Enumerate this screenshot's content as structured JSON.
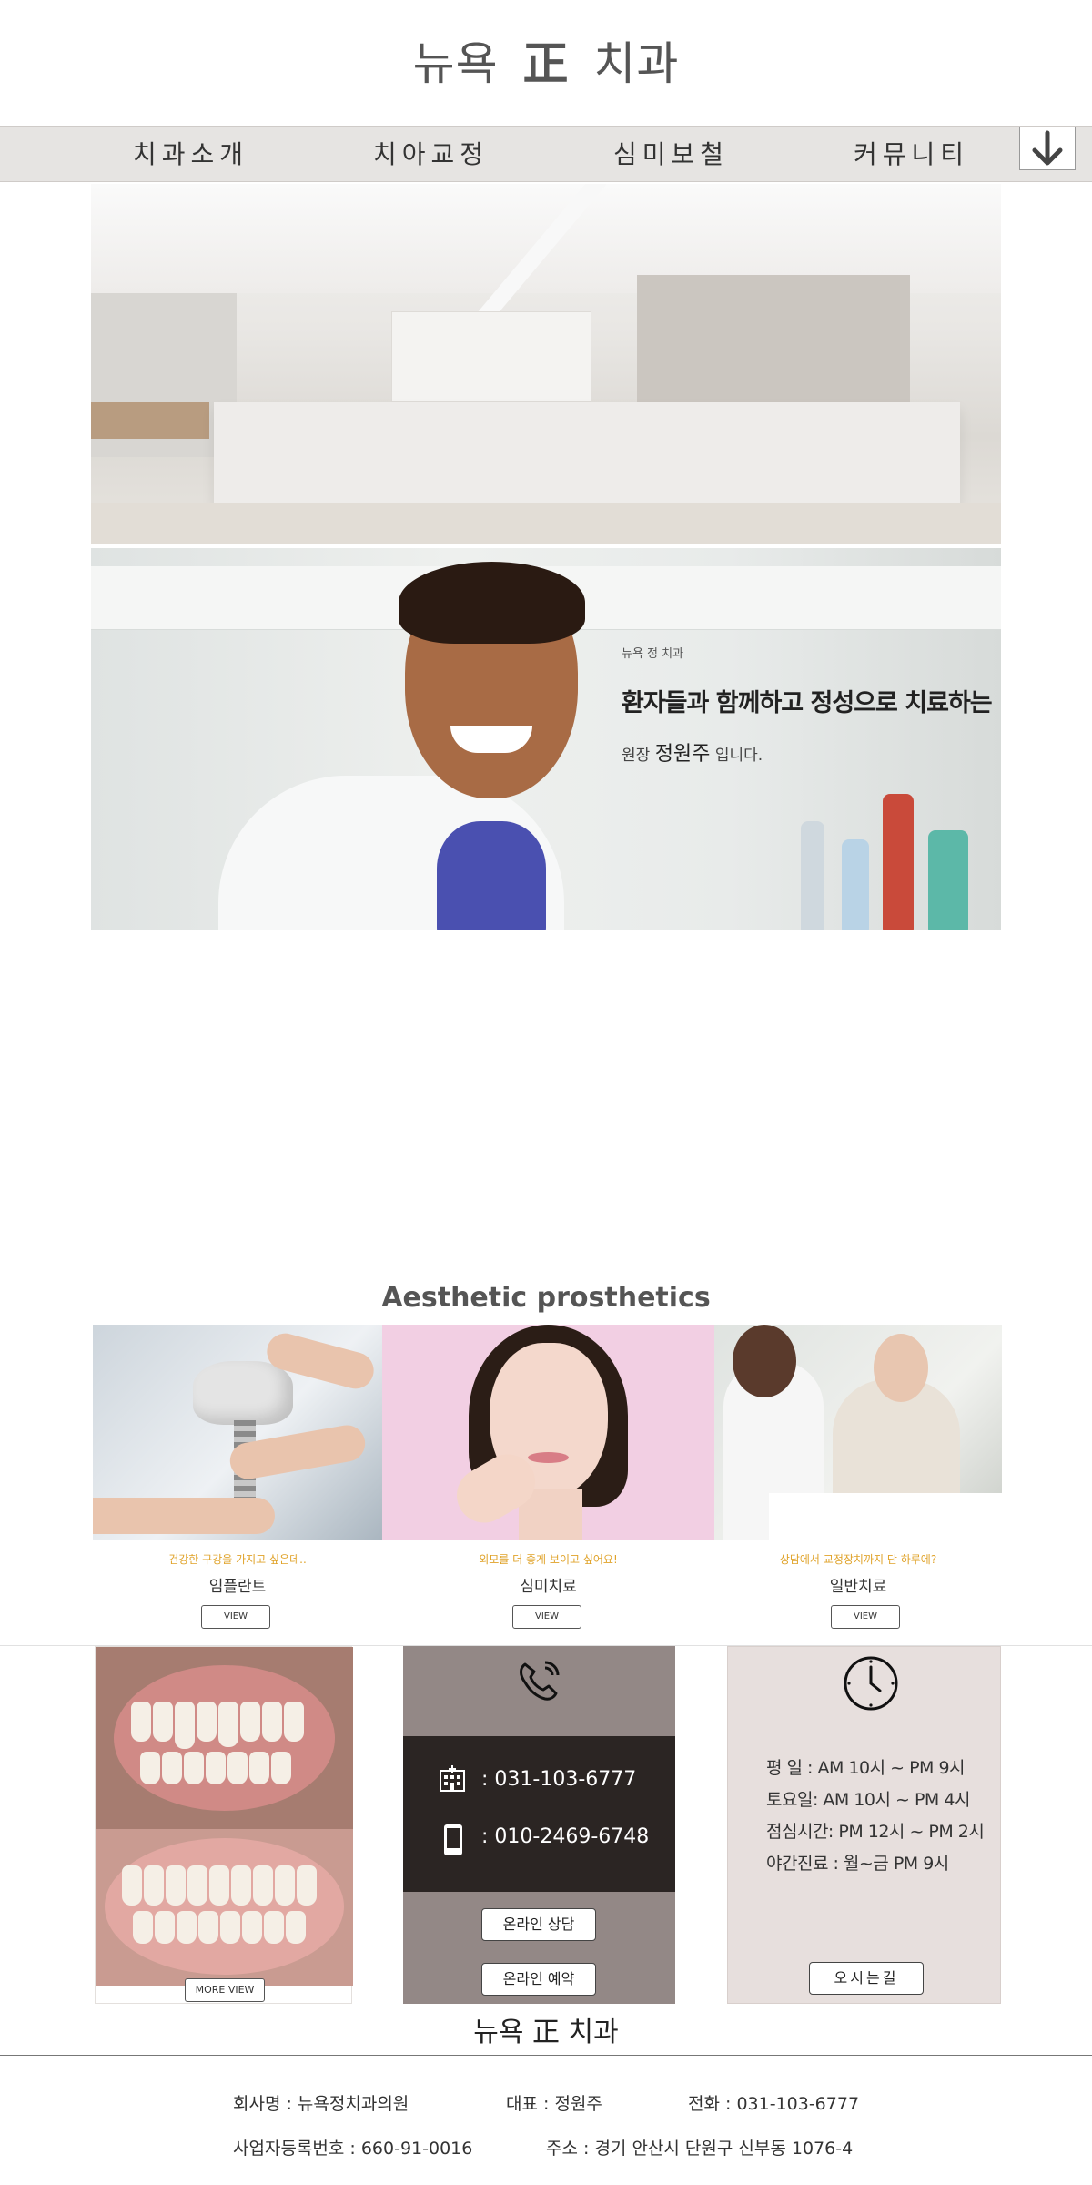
{
  "header": {
    "logo_left": "뉴욕",
    "logo_mid": "正",
    "logo_right": "치과"
  },
  "nav": {
    "items": [
      "치과소개",
      "치아교정",
      "심미보철",
      "커뮤니티"
    ],
    "arrow_icon": "arrow-down-icon"
  },
  "hero": {
    "small_caption": "뉴욕 정 치과",
    "headline": "환자들과 함께하고 정성으로 치료하는",
    "title_prefix": "원장",
    "name": "정원주",
    "suffix": "입니다."
  },
  "services": {
    "section_title": "Aesthetic prosthetics",
    "items": [
      {
        "subtitle": "건강한 구강을 가지고 싶은데..",
        "name": "임플란트",
        "button": "VIEW"
      },
      {
        "subtitle": "외모를 더 좋게 보이고 싶어요!",
        "name": "심미치료",
        "button": "VIEW"
      },
      {
        "subtitle": "상담에서 교정장치까지 단 하루에?",
        "name": "일반치료",
        "button": "VIEW"
      }
    ]
  },
  "gallery": {
    "button": "MORE VIEW"
  },
  "contact": {
    "phone_icon": "phone-icon",
    "hospital_icon": "hospital-icon",
    "mobile_icon": "mobile-icon",
    "tel": ": 031-103-6777",
    "mobile": ": 010-2469-6748",
    "consult_button": "온라인 상담",
    "reserve_button": "온라인 예약"
  },
  "hours": {
    "clock_icon": "clock-icon",
    "lines": [
      "평  일 : AM 10시 ~ PM 9시",
      "토요일: AM 10시 ~ PM 4시",
      "점심시간: PM 12시 ~ PM 2시",
      "야간진료 : 월~금 PM 9시"
    ],
    "directions_button": "오시는길"
  },
  "footer": {
    "title": "뉴욕 正 치과",
    "company": "회사명 : 뉴욕정치과의원",
    "ceo": "대표 : 정원주",
    "phone": "전화 : 031-103-6777",
    "biz_no": "사업자등록번호 : 660-91-0016",
    "address": "주소 : 경기 안산시 단원구 신부동 1076-4"
  },
  "colors": {
    "nav_bg": "#e6e4e2",
    "accent_orange": "#e0a32a",
    "contact_bg": "#938886",
    "contact_dark": "#2b2523",
    "hours_bg": "#e7dfdd"
  }
}
